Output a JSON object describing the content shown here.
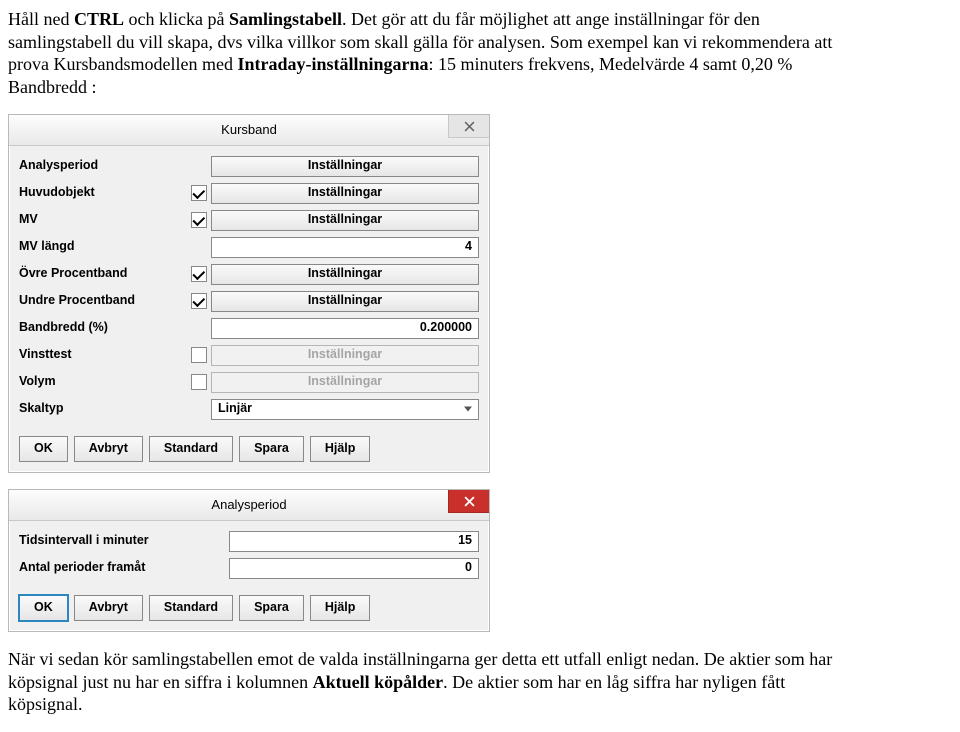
{
  "para1": {
    "t1": "Håll ned ",
    "b1": "CTRL",
    "t2": " och klicka på ",
    "b2": "Samlingstabell",
    "t3": ". Det gör att du får möjlighet att ange inställningar för den samlingstabell du vill skapa, dvs vilka villkor som skall gälla för analysen. Som exempel kan vi rekommendera att prova Kursbandsmodellen med ",
    "b3": "Intraday-inställningarna",
    "t4": ": 15 minuters frekvens, Medelvärde 4 samt 0,20 % Bandbredd :"
  },
  "dialog1": {
    "title": "Kursband",
    "close": "×",
    "rows": {
      "analysperiod": {
        "label": "Analysperiod",
        "btn": "Inställningar"
      },
      "huvudobjekt": {
        "label": "Huvudobjekt",
        "btn": "Inställningar"
      },
      "mv": {
        "label": "MV",
        "btn": "Inställningar"
      },
      "mvlangd": {
        "label": "MV längd",
        "value": "4"
      },
      "ovre": {
        "label": "Övre Procentband",
        "btn": "Inställningar"
      },
      "undre": {
        "label": "Undre Procentband",
        "btn": "Inställningar"
      },
      "bandbredd": {
        "label": "Bandbredd (%)",
        "value": "0.200000"
      },
      "vinsttest": {
        "label": "Vinsttest",
        "btn": "Inställningar"
      },
      "volym": {
        "label": "Volym",
        "btn": "Inställningar"
      },
      "skaltyp": {
        "label": "Skaltyp",
        "value": "Linjär"
      }
    },
    "buttons": {
      "ok": "OK",
      "avbryt": "Avbryt",
      "standard": "Standard",
      "spara": "Spara",
      "hjalp": "Hjälp"
    }
  },
  "dialog2": {
    "title": "Analysperiod",
    "rows": {
      "tidsintervall": {
        "label": "Tidsintervall i minuter",
        "value": "15"
      },
      "perioder": {
        "label": "Antal perioder framåt",
        "value": "0"
      }
    },
    "buttons": {
      "ok": "OK",
      "avbryt": "Avbryt",
      "standard": "Standard",
      "spara": "Spara",
      "hjalp": "Hjälp"
    }
  },
  "para2": {
    "t1": "När vi sedan kör samlingstabellen emot de valda inställningarna ger detta ett utfall enligt nedan. De aktier som har köpsignal just nu har en siffra i kolumnen ",
    "b1": "Aktuell köpålder",
    "t2": ". De aktier som har en låg siffra har nyligen fått köpsignal."
  }
}
